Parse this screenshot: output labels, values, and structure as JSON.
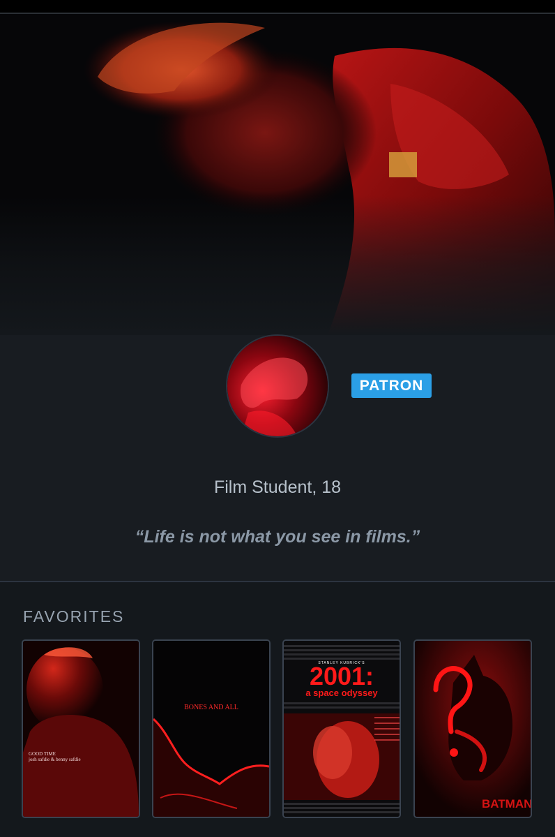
{
  "profile": {
    "badge": "PATRON",
    "bio": "Film Student, 18",
    "quote": "“Life is not what you see in films.”"
  },
  "favorites": {
    "title": "FAVORITES",
    "posters": [
      {
        "name": "good-time-poster",
        "lines": [
          "GOOD TIME",
          "josh safdie & benny safdie"
        ]
      },
      {
        "name": "bones-and-all-poster",
        "title": "BONES AND ALL"
      },
      {
        "name": "2001-poster",
        "top": "STANLEY KUBRICK'S",
        "title": "2001:",
        "subtitle": "a space odyssey"
      },
      {
        "name": "the-batman-poster",
        "title": "BATMAN"
      }
    ]
  },
  "colors": {
    "background": "#14181c",
    "badge": "#2b9fe6",
    "accent_red": "#ff1a1a"
  }
}
